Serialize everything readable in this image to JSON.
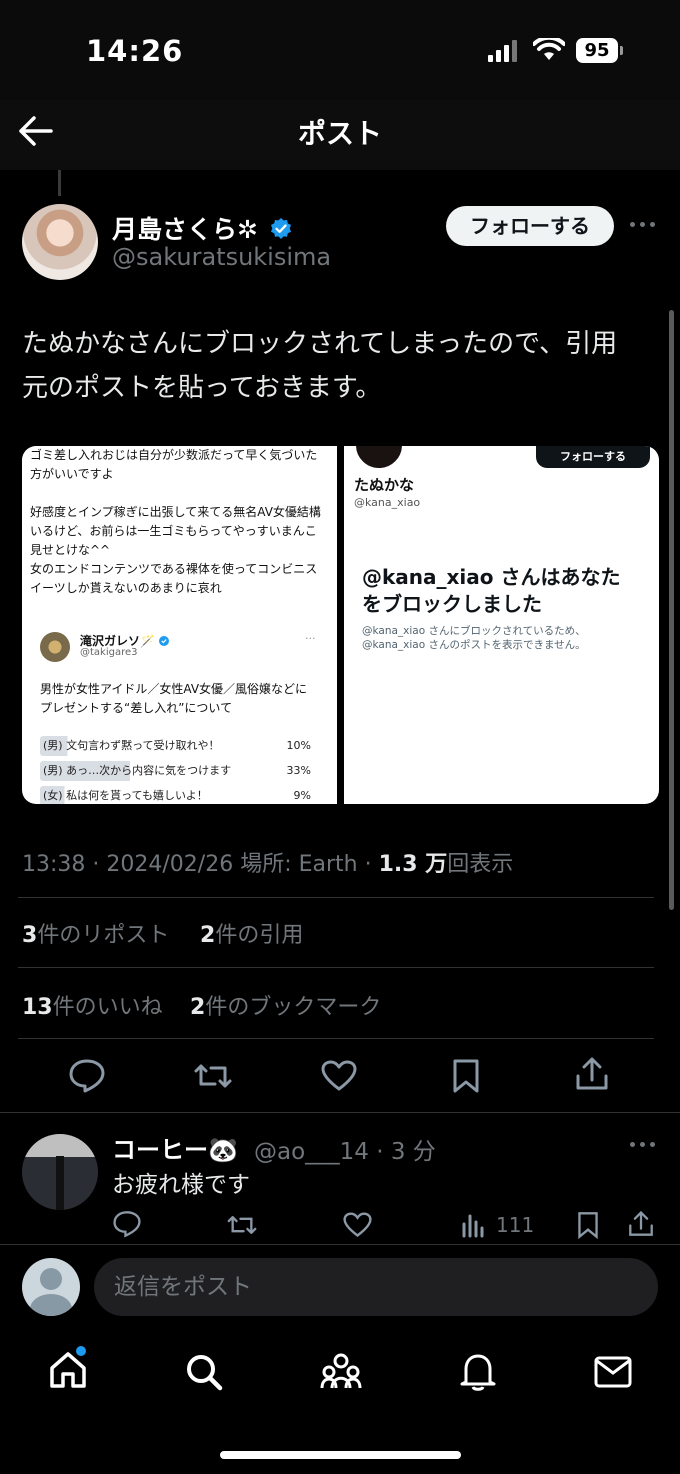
{
  "status_bar": {
    "time": "14:26",
    "battery": "95"
  },
  "header": {
    "title": "ポスト"
  },
  "author": {
    "name": "月島さくら✲",
    "handle": "@sakuratsukisima",
    "follow_label": "フォローする"
  },
  "post": {
    "text": "たぬかなさんにブロックされてしまったので、引用元のポストを貼っておきます。"
  },
  "media_left": {
    "lines": [
      "ゴミ差し入れおじは自分が少数派だって早く気づいた",
      "方がいいですよ",
      "",
      "好感度とインプ稼ぎに出張して来てる無名AV女優結構",
      "いるけど、お前らは一生ゴミもらってやっすいまんこ",
      "見せとけな^^",
      "女のエンドコンテンツである裸体を使ってコンビニス",
      "イーツしか貰えないのあまりに哀れ"
    ],
    "quoted_name": "滝沢ガレソ🪄",
    "quoted_handle": "@takigare3",
    "quoted_text": [
      "男性が女性アイドル／女性AV女優／風俗嬢などに",
      "プレゼントする“差し入れ”について"
    ],
    "poll": [
      {
        "label": "(男) 文句言わず黙って受け取れや！",
        "pct": "10%",
        "fill": 0.1
      },
      {
        "label": "(男) あっ…次から内容に気をつけます",
        "pct": "33%",
        "fill": 0.33
      },
      {
        "label": "(女) 私は何を貰っても嬉しいよ！",
        "pct": "9%",
        "fill": 0.09
      }
    ]
  },
  "media_right": {
    "follow_label": "フォローする",
    "name": "たぬかな",
    "handle": "@kana_xiao",
    "blocked_title_1": "@kana_xiao さんはあなた",
    "blocked_title_2": "をブロックしました",
    "blocked_sub_1": "@kana_xiao さんにブロックされているため、",
    "blocked_sub_2": "@kana_xiao さんのポストを表示できません。"
  },
  "meta": {
    "time": "13:38",
    "date": "2024/02/26",
    "location": "場所: Earth",
    "views_num": "1.3 万",
    "views_label": "回表示"
  },
  "stats": {
    "reposts_num": "3",
    "reposts_label": "件のリポスト",
    "quotes_num": "2",
    "quotes_label": "件の引用",
    "likes_num": "13",
    "likes_label": "件のいいね",
    "bookmarks_num": "2",
    "bookmarks_label": "件のブックマーク"
  },
  "reply": {
    "name": "コーヒー🐼",
    "handle": "@ao___14 · 3 分",
    "text": "お疲れ様です",
    "views": "111"
  },
  "composer": {
    "placeholder": "返信をポスト"
  },
  "colors": {
    "accent": "#1d9bf0",
    "background": "#000000",
    "muted": "#71767b"
  }
}
